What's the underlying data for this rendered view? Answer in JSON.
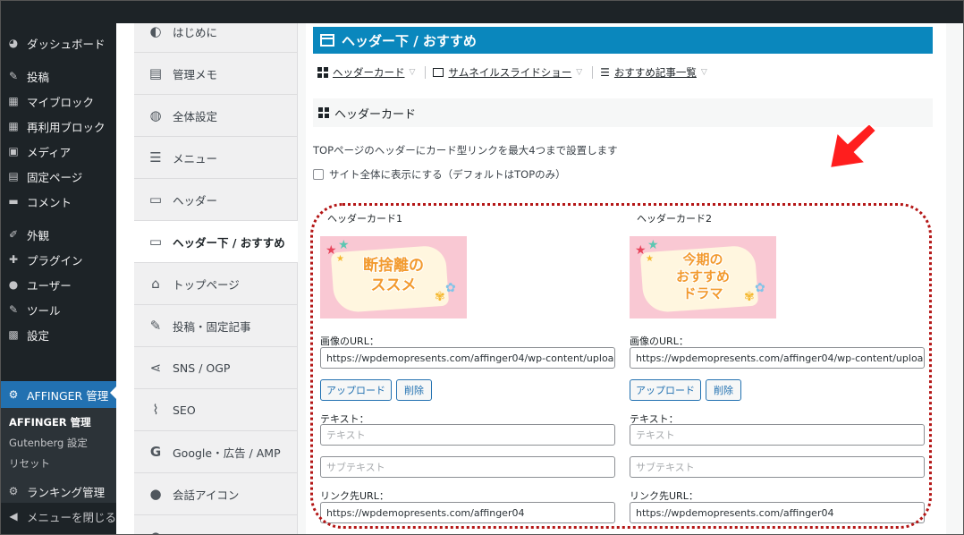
{
  "wp_sidebar": {
    "items": [
      {
        "label": "ダッシュボード",
        "icon": "dashboard-icon",
        "glyph": "◕"
      },
      {
        "label": "投稿",
        "icon": "pin-icon",
        "glyph": "✎"
      },
      {
        "label": "マイブロック",
        "icon": "blocks-icon",
        "glyph": "▦"
      },
      {
        "label": "再利用ブロック",
        "icon": "blocks-icon",
        "glyph": "▦"
      },
      {
        "label": "メディア",
        "icon": "media-icon",
        "glyph": "▣"
      },
      {
        "label": "固定ページ",
        "icon": "page-icon",
        "glyph": "▤"
      },
      {
        "label": "コメント",
        "icon": "comment-icon",
        "glyph": "▬"
      },
      {
        "label": "外観",
        "icon": "brush-icon",
        "glyph": "✐"
      },
      {
        "label": "プラグイン",
        "icon": "plugin-icon",
        "glyph": "✚"
      },
      {
        "label": "ユーザー",
        "icon": "user-icon",
        "glyph": "●"
      },
      {
        "label": "ツール",
        "icon": "wrench-icon",
        "glyph": "✎"
      },
      {
        "label": "設定",
        "icon": "settings-icon",
        "glyph": "▩"
      },
      {
        "label": "AFFINGER 管理",
        "icon": "gear-icon",
        "glyph": "⚙",
        "current": true
      },
      {
        "label": "ランキング管理",
        "icon": "gear-icon",
        "glyph": "⚙"
      },
      {
        "label": "メニューを閉じる",
        "icon": "collapse-icon",
        "glyph": "◀"
      }
    ],
    "submenu": [
      "AFFINGER 管理",
      "Gutenberg 設定",
      "リセット"
    ]
  },
  "plugin_nav": {
    "items": [
      {
        "label": "はじめに",
        "icon": "beginner-icon",
        "glyph": "◐"
      },
      {
        "label": "管理メモ",
        "icon": "memo-icon",
        "glyph": "▤"
      },
      {
        "label": "全体設定",
        "icon": "palette-icon",
        "glyph": "◍"
      },
      {
        "label": "メニュー",
        "icon": "menu-icon",
        "glyph": "☰"
      },
      {
        "label": "ヘッダー",
        "icon": "header-icon",
        "glyph": "▭"
      },
      {
        "label": "ヘッダー下 / おすすめ",
        "icon": "header-below-icon",
        "glyph": "▭",
        "active": true
      },
      {
        "label": "トップページ",
        "icon": "home-icon",
        "glyph": "⌂"
      },
      {
        "label": "投稿・固定記事",
        "icon": "edit-icon",
        "glyph": "✎"
      },
      {
        "label": "SNS / OGP",
        "icon": "share-icon",
        "glyph": "⋖"
      },
      {
        "label": "SEO",
        "icon": "chart-icon",
        "glyph": "⌇"
      },
      {
        "label": "Google・広告 / AMP",
        "icon": "google-icon",
        "glyph": "G"
      },
      {
        "label": "会話アイコン",
        "icon": "chat-icon",
        "glyph": "●"
      }
    ]
  },
  "page": {
    "title": "ヘッダー下 / おすすめ",
    "tabs": [
      "ヘッダーカード",
      "サムネイルスライドショー",
      "おすすめ記事一覧"
    ],
    "section_title": "ヘッダーカード",
    "description": "TOPページのヘッダーにカード型リンクを最大4つまで設置します",
    "checkbox_label": "サイト全体に表示にする（デフォルトはTOPのみ）"
  },
  "cards": [
    {
      "title": "ヘッダーカード1",
      "image_text": [
        "断捨離の",
        "ススメ"
      ],
      "image_url_label": "画像のURL：",
      "image_url": "https://wpdemopresents.com/affinger04/wp-content/uploads/",
      "upload_label": "アップロード",
      "delete_label": "削除",
      "text_label": "テキスト：",
      "text_placeholder": "テキスト",
      "subtext_placeholder": "サブテキスト",
      "link_label": "リンク先URL：",
      "link_url": "https://wpdemopresents.com/affinger04"
    },
    {
      "title": "ヘッダーカード2",
      "image_text": [
        "今期の",
        "おすすめ",
        "ドラマ"
      ],
      "image_url_label": "画像のURL：",
      "image_url": "https://wpdemopresents.com/affinger04/wp-content/uploads/",
      "upload_label": "アップロード",
      "delete_label": "削除",
      "text_label": "テキスト：",
      "text_placeholder": "テキスト",
      "subtext_placeholder": "サブテキスト",
      "link_label": "リンク先URL：",
      "link_url": "https://wpdemopresents.com/affinger04"
    }
  ],
  "colors": {
    "accent": "#0a87bd",
    "wp_dark": "#1d2327",
    "highlight": "#b41616",
    "arrow": "#ff1e1e"
  }
}
